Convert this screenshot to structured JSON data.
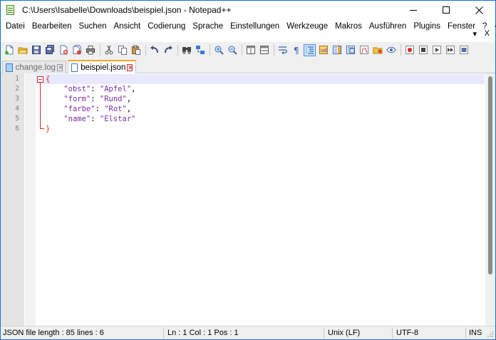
{
  "window": {
    "title": "C:\\Users\\Isabelle\\Downloads\\beispiel.json - Notepad++"
  },
  "menu": {
    "items": [
      "Datei",
      "Bearbeiten",
      "Suchen",
      "Ansicht",
      "Codierung",
      "Sprache",
      "Einstellungen",
      "Werkzeuge",
      "Makros",
      "Ausführen",
      "Plugins",
      "Fenster",
      "?"
    ],
    "plus": "+",
    "chevron": "▾",
    "close": "X"
  },
  "toolbar": {
    "icons": [
      "new-file-icon",
      "open-file-icon",
      "save-icon",
      "save-all-icon",
      "close-icon",
      "close-all-icon",
      "print-icon",
      "cut-icon",
      "copy-icon",
      "paste-icon",
      "undo-icon",
      "redo-icon",
      "find-icon",
      "replace-icon",
      "zoom-in-icon",
      "zoom-out-icon",
      "sync-vertical-icon",
      "sync-horizontal-icon",
      "word-wrap-icon",
      "show-all-chars-icon",
      "indent-guide-icon",
      "udl-icon",
      "doc-map-icon",
      "function-list-icon",
      "folder-workspace-icon",
      "monitoring-icon",
      "record-macro-icon",
      "stop-macro-icon",
      "play-macro-icon",
      "run-macro-multiple-icon",
      "save-macro-icon"
    ]
  },
  "tabs": [
    {
      "label": "change.log",
      "active": false
    },
    {
      "label": "beispiel.json",
      "active": true
    }
  ],
  "editor": {
    "line_numbers": [
      "1",
      "2",
      "3",
      "4",
      "5",
      "6"
    ],
    "lines": [
      {
        "indent": "",
        "parts": [
          {
            "t": "{",
            "c": "brace"
          }
        ]
      },
      {
        "indent": "    ",
        "parts": [
          {
            "t": "\"obst\"",
            "c": "key"
          },
          {
            "t": ": ",
            "c": "punct"
          },
          {
            "t": "\"Apfel\"",
            "c": "str"
          },
          {
            "t": ",",
            "c": "punct"
          }
        ]
      },
      {
        "indent": "    ",
        "parts": [
          {
            "t": "\"form\"",
            "c": "key"
          },
          {
            "t": ": ",
            "c": "punct"
          },
          {
            "t": "\"Rund\"",
            "c": "str"
          },
          {
            "t": ",",
            "c": "punct"
          }
        ]
      },
      {
        "indent": "    ",
        "parts": [
          {
            "t": "\"farbe\"",
            "c": "key"
          },
          {
            "t": ": ",
            "c": "punct"
          },
          {
            "t": "\"Rot\"",
            "c": "str"
          },
          {
            "t": ",",
            "c": "punct"
          }
        ]
      },
      {
        "indent": "    ",
        "parts": [
          {
            "t": "\"name\"",
            "c": "key"
          },
          {
            "t": ": ",
            "c": "punct"
          },
          {
            "t": "\"Elstar\"",
            "c": "str"
          }
        ]
      },
      {
        "indent": "",
        "parts": [
          {
            "t": "}",
            "c": "brace"
          }
        ]
      }
    ]
  },
  "status": {
    "file_info": "JSON file length : 85    lines : 6",
    "position": "Ln : 1    Col : 1    Pos : 1",
    "eol": "Unix (LF)",
    "encoding": "UTF-8",
    "mode": "INS"
  },
  "colors": {
    "key": "#7a2ea0",
    "brace": "#d62c2c",
    "current_line": "#e8e8ff",
    "tab_accent": "#f6a828"
  }
}
